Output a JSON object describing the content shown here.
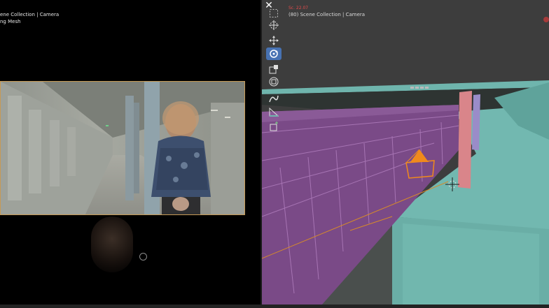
{
  "left_viewport": {
    "overlay_line1": "ene Collection | Camera",
    "overlay_line2": "ng Mesh"
  },
  "right_viewport": {
    "frame_label": "Sc. 22.07",
    "overlay_line1": "(80) Scene Collection | Camera"
  },
  "toolbar": {
    "close_symbol": "✕",
    "tools": [
      {
        "name": "select-box",
        "icon": "select-box-icon"
      },
      {
        "name": "cursor",
        "icon": "cursor-icon"
      },
      {
        "name": "move",
        "icon": "move-icon"
      },
      {
        "name": "rotate",
        "icon": "rotate-icon",
        "active": true
      },
      {
        "name": "scale",
        "icon": "scale-icon"
      },
      {
        "name": "transform",
        "icon": "transform-icon"
      },
      {
        "name": "annotate",
        "icon": "annotate-icon"
      },
      {
        "name": "measure",
        "icon": "measure-icon"
      },
      {
        "name": "add-cube",
        "icon": "add-cube-icon"
      }
    ]
  },
  "colors": {
    "active_tool": "#4772b3",
    "train_mesh": "#7a4a87",
    "platform_mesh": "#6fb5ad",
    "camera_selected": "#f08a1c",
    "frame_text": "#e34b4b"
  }
}
